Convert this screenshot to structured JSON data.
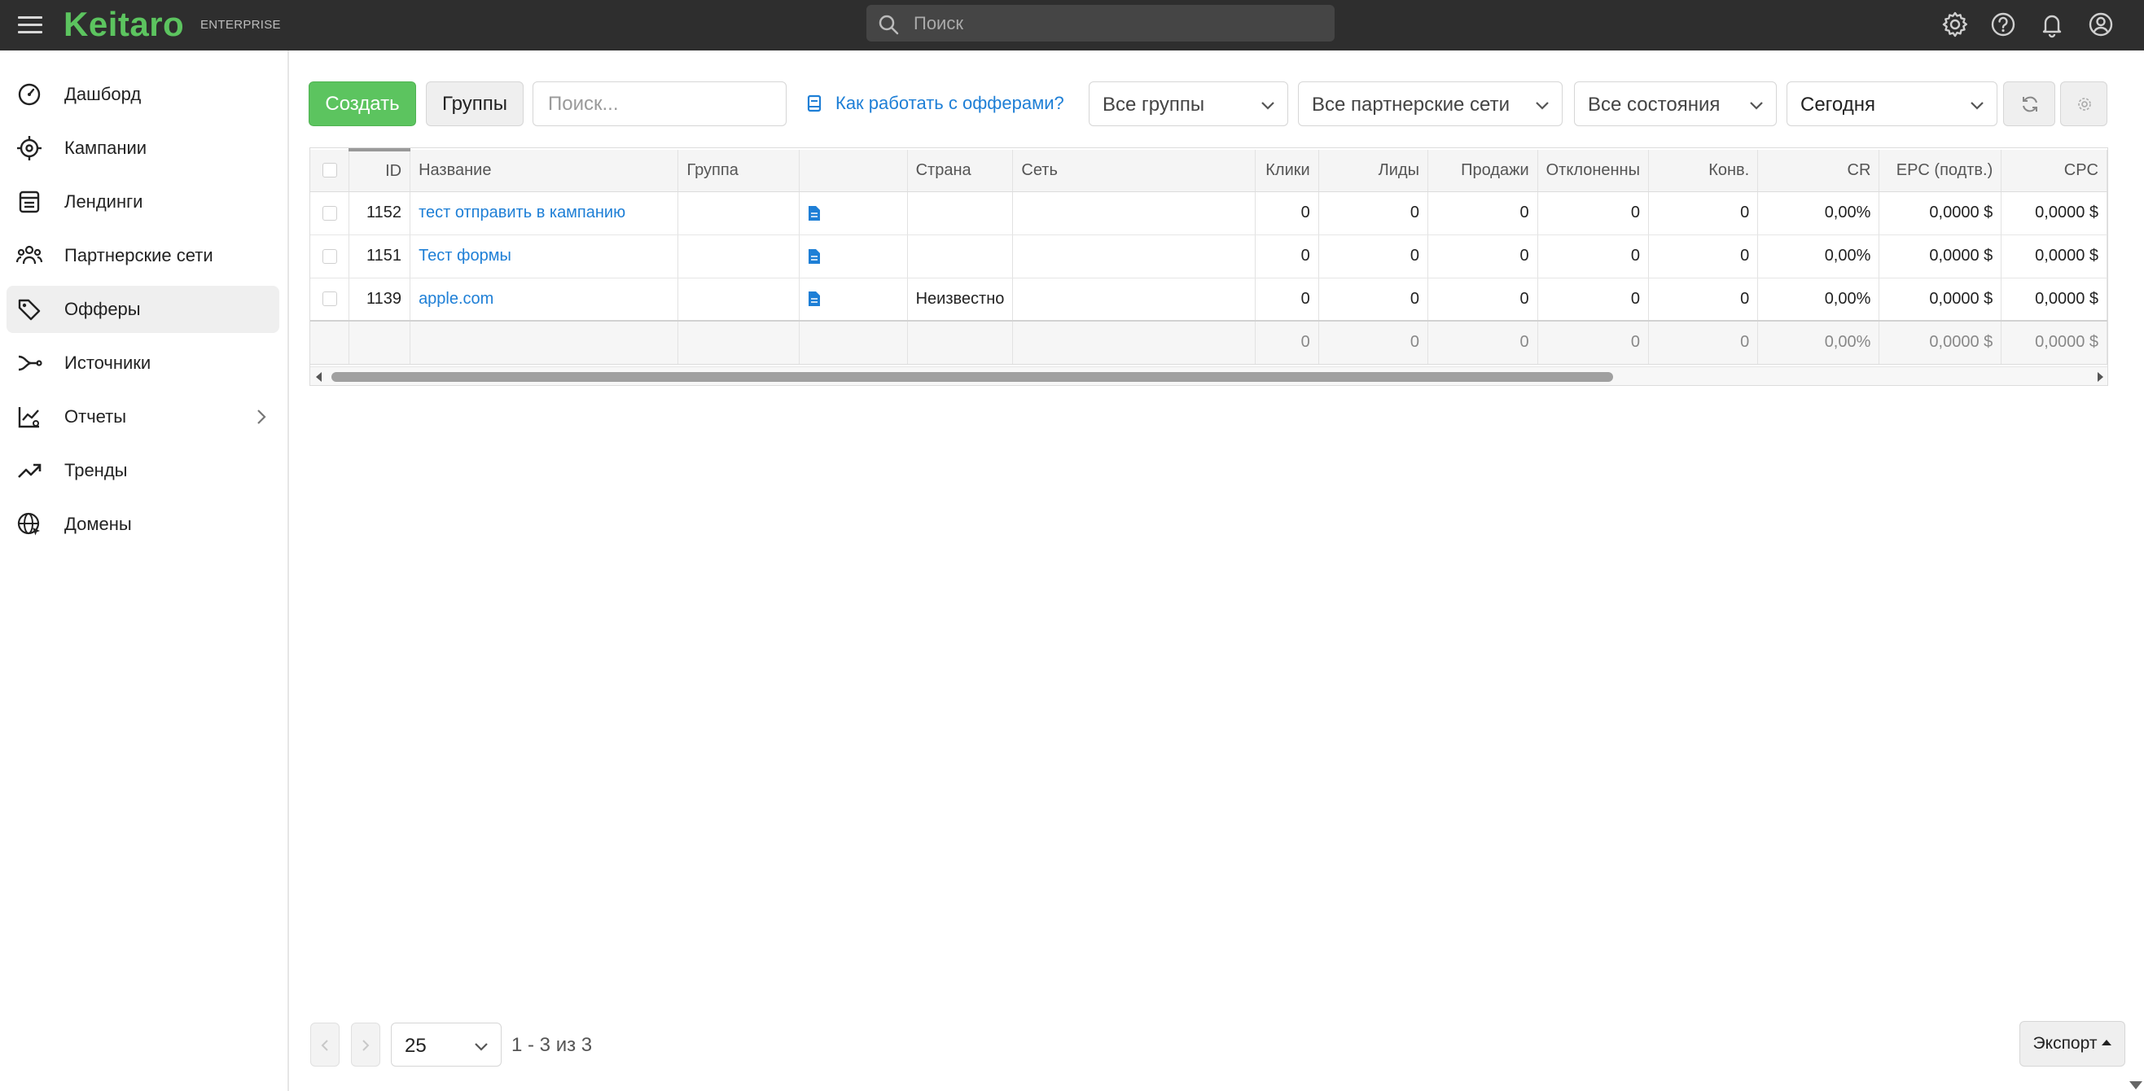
{
  "brand": {
    "name": "Keitaro",
    "edition": "ENTERPRISE",
    "accent": "#5cc45f",
    "link_color": "#1e7fd6"
  },
  "topbar": {
    "search_placeholder": "Поиск"
  },
  "sidebar": {
    "items": [
      {
        "label": "Дашборд",
        "icon": "dashboard-icon"
      },
      {
        "label": "Кампании",
        "icon": "target-icon"
      },
      {
        "label": "Лендинги",
        "icon": "landing-page-icon"
      },
      {
        "label": "Партнерские сети",
        "icon": "people-icon"
      },
      {
        "label": "Офферы",
        "icon": "tag-icon",
        "active": true
      },
      {
        "label": "Источники",
        "icon": "route-icon"
      },
      {
        "label": "Отчеты",
        "icon": "report-chart-icon",
        "has_submenu": true
      },
      {
        "label": "Тренды",
        "icon": "trending-up-icon"
      },
      {
        "label": "Домены",
        "icon": "globe-icon"
      }
    ]
  },
  "toolbar": {
    "create_label": "Создать",
    "groups_label": "Группы",
    "search_placeholder": "Поиск...",
    "help_link": "Как работать с офферами?",
    "filter_groups": "Все группы",
    "filter_networks": "Все партнерские сети",
    "filter_states": "Все состояния",
    "filter_date": "Сегодня"
  },
  "table": {
    "headers": {
      "id": "ID",
      "name": "Название",
      "group": "Группа",
      "type": "",
      "country": "Страна",
      "network": "Сеть",
      "clicks": "Клики",
      "leads": "Лиды",
      "sales": "Продажи",
      "rejected": "Отклоненны",
      "conv": "Конв.",
      "cr": "CR",
      "epc": "EPC (подтв.)",
      "cpc": "CPC"
    },
    "rows": [
      {
        "id": "1152",
        "name": "тест отправить в кампанию",
        "group": "",
        "country": "",
        "network": "",
        "clicks": "0",
        "leads": "0",
        "sales": "0",
        "rejected": "0",
        "conv": "0",
        "cr": "0,00%",
        "epc": "0,0000 $",
        "cpc": "0,0000 $"
      },
      {
        "id": "1151",
        "name": "Тест формы",
        "group": "",
        "country": "",
        "network": "",
        "clicks": "0",
        "leads": "0",
        "sales": "0",
        "rejected": "0",
        "conv": "0",
        "cr": "0,00%",
        "epc": "0,0000 $",
        "cpc": "0,0000 $"
      },
      {
        "id": "1139",
        "name": "apple.com",
        "group": "",
        "country": "Неизвестно",
        "network": "",
        "clicks": "0",
        "leads": "0",
        "sales": "0",
        "rejected": "0",
        "conv": "0",
        "cr": "0,00%",
        "epc": "0,0000 $",
        "cpc": "0,0000 $"
      }
    ],
    "totals": {
      "clicks": "0",
      "leads": "0",
      "sales": "0",
      "rejected": "0",
      "conv": "0",
      "cr": "0,00%",
      "epc": "0,0000 $",
      "cpc": "0,0000 $"
    }
  },
  "pagination": {
    "per_page": "25",
    "range": "1 - 3 из 3"
  },
  "export_label": "Экспорт"
}
